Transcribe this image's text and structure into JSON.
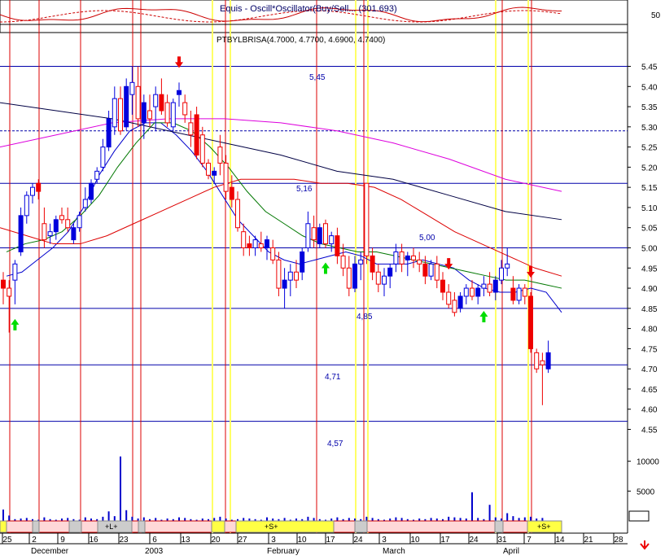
{
  "indicator_panel": {
    "title": "Equis - Oscill*Oscillator(Buy/Sell... (301.693)",
    "axis_label": "50"
  },
  "price_panel": {
    "ohlc_caption": "PTBYLBRISA(4.7000, 4.7700, 4.6900, 4.7400)",
    "y_ticks": [
      "5.45",
      "5.40",
      "5.35",
      "5.30",
      "5.25",
      "5.20",
      "5.15",
      "5.10",
      "5.05",
      "5.00",
      "4.95",
      "4.90",
      "4.85",
      "4.80",
      "4.75",
      "4.70",
      "4.65",
      "4.60",
      "4.55"
    ],
    "level_labels": [
      "5,45",
      "5,16",
      "5,00",
      "4,85",
      "4,71",
      "4,57"
    ]
  },
  "volume_panel": {
    "y_ticks": [
      "10000",
      "5000"
    ]
  },
  "signal_bar": {
    "labels": [
      "+L+",
      "+S+",
      "+S+"
    ]
  },
  "x_axis": {
    "day_labels": [
      "25",
      "2",
      "9",
      "16",
      "23",
      "30",
      "6",
      "13",
      "20",
      "27",
      "3",
      "10",
      "17",
      "24",
      "3",
      "10",
      "17",
      "24",
      "31",
      "7",
      "14",
      "21",
      "28"
    ],
    "month_labels": [
      "December",
      "2003",
      "February",
      "March",
      "April"
    ]
  },
  "colors": {
    "bull_candle": "#0000dd",
    "bear_candle": "#ee0000",
    "support_line": "#0000aa",
    "ma_short": "#0000cc",
    "ma_green": "#007700",
    "ma_red": "#dd0000",
    "ma_magenta": "#dd00dd",
    "ma_long": "#000044",
    "vline_red": "#dd0000",
    "vline_yellow": "#ffff66",
    "arrow_up": "#00dd00",
    "arrow_down": "#ee0000"
  },
  "chart_data": {
    "type": "candlestick",
    "ohlc_last": {
      "open": 4.7,
      "high": 4.77,
      "low": 4.69,
      "close": 4.74
    },
    "ylim": [
      4.55,
      5.45
    ],
    "horizontal_levels": [
      5.45,
      5.29,
      5.16,
      5.0,
      4.85,
      4.71,
      4.57
    ],
    "candles": [
      {
        "o": 4.92,
        "h": 4.94,
        "l": 4.86,
        "c": 4.9
      },
      {
        "o": 4.9,
        "h": 4.92,
        "l": 4.79,
        "c": 4.88
      },
      {
        "o": 4.92,
        "h": 4.97,
        "l": 4.86,
        "c": 4.96
      },
      {
        "o": 4.99,
        "h": 5.1,
        "l": 4.98,
        "c": 5.08
      },
      {
        "o": 5.08,
        "h": 5.14,
        "l": 5.06,
        "c": 5.13
      },
      {
        "o": 5.13,
        "h": 5.16,
        "l": 5.11,
        "c": 5.15
      },
      {
        "o": 5.16,
        "h": 5.17,
        "l": 5.12,
        "c": 5.14
      },
      {
        "o": 5.06,
        "h": 5.1,
        "l": 5.0,
        "c": 5.02
      },
      {
        "o": 5.03,
        "h": 5.06,
        "l": 5.01,
        "c": 5.04
      },
      {
        "o": 5.04,
        "h": 5.08,
        "l": 5.02,
        "c": 5.07
      },
      {
        "o": 5.08,
        "h": 5.1,
        "l": 5.06,
        "c": 5.07
      },
      {
        "o": 5.07,
        "h": 5.1,
        "l": 5.04,
        "c": 5.05
      },
      {
        "o": 5.02,
        "h": 5.06,
        "l": 5.01,
        "c": 5.05
      },
      {
        "o": 5.05,
        "h": 5.09,
        "l": 5.04,
        "c": 5.08
      },
      {
        "o": 5.1,
        "h": 5.15,
        "l": 5.09,
        "c": 5.12
      },
      {
        "o": 5.12,
        "h": 5.17,
        "l": 5.11,
        "c": 5.16
      },
      {
        "o": 5.17,
        "h": 5.2,
        "l": 5.16,
        "c": 5.19
      },
      {
        "o": 5.2,
        "h": 5.27,
        "l": 5.19,
        "c": 5.25
      },
      {
        "o": 5.25,
        "h": 5.34,
        "l": 5.24,
        "c": 5.32
      },
      {
        "o": 5.3,
        "h": 5.4,
        "l": 5.28,
        "c": 5.37
      },
      {
        "o": 5.37,
        "h": 5.4,
        "l": 5.28,
        "c": 5.29
      },
      {
        "o": 5.3,
        "h": 5.42,
        "l": 5.29,
        "c": 5.4
      },
      {
        "o": 5.38,
        "h": 5.45,
        "l": 5.33,
        "c": 5.41
      },
      {
        "o": 5.4,
        "h": 5.45,
        "l": 5.3,
        "c": 5.32
      },
      {
        "o": 5.31,
        "h": 5.38,
        "l": 5.27,
        "c": 5.36
      },
      {
        "o": 5.34,
        "h": 5.38,
        "l": 5.3,
        "c": 5.32
      },
      {
        "o": 5.35,
        "h": 5.4,
        "l": 5.29,
        "c": 5.38
      },
      {
        "o": 5.38,
        "h": 5.42,
        "l": 5.33,
        "c": 5.34
      },
      {
        "o": 5.36,
        "h": 5.38,
        "l": 5.3,
        "c": 5.31
      },
      {
        "o": 5.3,
        "h": 5.37,
        "l": 5.29,
        "c": 5.36
      },
      {
        "o": 5.38,
        "h": 5.41,
        "l": 5.35,
        "c": 5.39
      },
      {
        "o": 5.36,
        "h": 5.38,
        "l": 5.31,
        "c": 5.33
      },
      {
        "o": 5.31,
        "h": 5.34,
        "l": 5.25,
        "c": 5.28
      },
      {
        "o": 5.33,
        "h": 5.35,
        "l": 5.22,
        "c": 5.23
      },
      {
        "o": 5.28,
        "h": 5.3,
        "l": 5.2,
        "c": 5.21
      },
      {
        "o": 5.21,
        "h": 5.22,
        "l": 5.17,
        "c": 5.18
      },
      {
        "o": 5.18,
        "h": 5.2,
        "l": 5.16,
        "c": 5.19
      },
      {
        "o": 5.25,
        "h": 5.28,
        "l": 5.18,
        "c": 5.21
      },
      {
        "o": 5.21,
        "h": 5.23,
        "l": 5.12,
        "c": 5.14
      },
      {
        "o": 5.15,
        "h": 5.18,
        "l": 5.1,
        "c": 5.12
      },
      {
        "o": 5.12,
        "h": 5.14,
        "l": 5.04,
        "c": 5.05
      },
      {
        "o": 5.04,
        "h": 5.06,
        "l": 4.98,
        "c": 5.0
      },
      {
        "o": 5.01,
        "h": 5.03,
        "l": 4.98,
        "c": 5.0
      },
      {
        "o": 5.0,
        "h": 5.03,
        "l": 4.98,
        "c": 5.02
      },
      {
        "o": 5.01,
        "h": 5.04,
        "l": 4.99,
        "c": 5.0
      },
      {
        "o": 5.0,
        "h": 5.03,
        "l": 4.97,
        "c": 5.02
      },
      {
        "o": 5.0,
        "h": 5.02,
        "l": 4.96,
        "c": 4.97
      },
      {
        "o": 4.97,
        "h": 4.99,
        "l": 4.88,
        "c": 4.9
      },
      {
        "o": 4.9,
        "h": 4.95,
        "l": 4.85,
        "c": 4.92
      },
      {
        "o": 4.92,
        "h": 4.96,
        "l": 4.88,
        "c": 4.94
      },
      {
        "o": 4.94,
        "h": 4.97,
        "l": 4.9,
        "c": 4.92
      },
      {
        "o": 4.94,
        "h": 5.0,
        "l": 4.92,
        "c": 4.99
      },
      {
        "o": 5.0,
        "h": 5.09,
        "l": 4.99,
        "c": 5.06
      },
      {
        "o": 5.05,
        "h": 5.08,
        "l": 5.0,
        "c": 5.02
      },
      {
        "o": 5.01,
        "h": 5.06,
        "l": 5.0,
        "c": 5.05
      },
      {
        "o": 5.06,
        "h": 5.07,
        "l": 5.0,
        "c": 5.01
      },
      {
        "o": 5.01,
        "h": 5.04,
        "l": 4.99,
        "c": 5.03
      },
      {
        "o": 5.03,
        "h": 5.05,
        "l": 4.96,
        "c": 4.98
      },
      {
        "o": 4.98,
        "h": 5.01,
        "l": 4.93,
        "c": 4.95
      },
      {
        "o": 4.95,
        "h": 4.98,
        "l": 4.88,
        "c": 4.9
      },
      {
        "o": 4.9,
        "h": 4.98,
        "l": 4.89,
        "c": 4.96
      },
      {
        "o": 4.96,
        "h": 4.99,
        "l": 4.92,
        "c": 4.97
      },
      {
        "o": 5.16,
        "h": 5.16,
        "l": 4.96,
        "c": 4.98
      },
      {
        "o": 4.98,
        "h": 5.0,
        "l": 4.92,
        "c": 4.94
      },
      {
        "o": 4.94,
        "h": 4.96,
        "l": 4.89,
        "c": 4.91
      },
      {
        "o": 4.91,
        "h": 4.95,
        "l": 4.88,
        "c": 4.93
      },
      {
        "o": 4.93,
        "h": 4.96,
        "l": 4.9,
        "c": 4.95
      },
      {
        "o": 4.96,
        "h": 5.01,
        "l": 4.94,
        "c": 4.99
      },
      {
        "o": 4.99,
        "h": 5.01,
        "l": 4.94,
        "c": 4.96
      },
      {
        "o": 4.97,
        "h": 4.99,
        "l": 4.93,
        "c": 4.98
      },
      {
        "o": 4.98,
        "h": 5.0,
        "l": 4.95,
        "c": 4.97
      },
      {
        "o": 4.97,
        "h": 4.99,
        "l": 4.94,
        "c": 4.96
      },
      {
        "o": 4.96,
        "h": 4.98,
        "l": 4.91,
        "c": 4.93
      },
      {
        "o": 4.93,
        "h": 4.97,
        "l": 4.92,
        "c": 4.96
      },
      {
        "o": 4.96,
        "h": 4.98,
        "l": 4.9,
        "c": 4.92
      },
      {
        "o": 4.92,
        "h": 4.94,
        "l": 4.87,
        "c": 4.89
      },
      {
        "o": 4.89,
        "h": 4.91,
        "l": 4.85,
        "c": 4.86
      },
      {
        "o": 4.87,
        "h": 4.89,
        "l": 4.83,
        "c": 4.84
      },
      {
        "o": 4.85,
        "h": 4.89,
        "l": 4.84,
        "c": 4.88
      },
      {
        "o": 4.88,
        "h": 4.91,
        "l": 4.86,
        "c": 4.9
      },
      {
        "o": 4.9,
        "h": 4.92,
        "l": 4.87,
        "c": 4.88
      },
      {
        "o": 4.88,
        "h": 4.91,
        "l": 4.86,
        "c": 4.9
      },
      {
        "o": 4.9,
        "h": 4.93,
        "l": 4.88,
        "c": 4.91
      },
      {
        "o": 4.91,
        "h": 4.94,
        "l": 4.88,
        "c": 4.89
      },
      {
        "o": 4.89,
        "h": 4.93,
        "l": 4.87,
        "c": 4.92
      },
      {
        "o": 4.92,
        "h": 4.97,
        "l": 4.91,
        "c": 4.95
      },
      {
        "o": 4.95,
        "h": 5.0,
        "l": 4.93,
        "c": 4.96
      },
      {
        "o": 4.9,
        "h": 4.93,
        "l": 4.86,
        "c": 4.87
      },
      {
        "o": 4.87,
        "h": 4.91,
        "l": 4.86,
        "c": 4.9
      },
      {
        "o": 4.9,
        "h": 4.91,
        "l": 4.86,
        "c": 4.88
      },
      {
        "o": 4.88,
        "h": 4.89,
        "l": 4.74,
        "c": 4.75
      },
      {
        "o": 4.74,
        "h": 4.75,
        "l": 4.69,
        "c": 4.7
      },
      {
        "o": 4.72,
        "h": 4.74,
        "l": 4.61,
        "c": 4.71
      },
      {
        "o": 4.7,
        "h": 4.77,
        "l": 4.69,
        "c": 4.74
      }
    ],
    "moving_averages": [
      {
        "name": "short",
        "points": [
          4.93,
          4.94,
          4.97,
          5.0,
          5.04,
          5.1,
          5.18,
          5.24,
          5.29,
          5.31,
          5.31,
          5.28,
          5.24,
          5.19,
          5.13,
          5.07,
          5.03,
          4.99,
          4.97,
          4.96,
          4.97,
          4.98,
          4.99,
          4.98,
          4.96,
          4.96,
          4.96,
          4.97,
          4.96,
          4.95,
          4.92,
          4.9,
          4.89,
          4.89,
          4.9,
          4.89,
          4.84
        ]
      },
      {
        "name": "green",
        "points": [
          4.99,
          5.01,
          5.02,
          5.04,
          5.08,
          5.13,
          5.2,
          5.26,
          5.31,
          5.31,
          5.29,
          5.25,
          5.2,
          5.14,
          5.09,
          5.06,
          5.03,
          5.01,
          5.0,
          4.99,
          4.99,
          4.98,
          4.97,
          4.96,
          4.95,
          4.94,
          4.93,
          4.92,
          4.92,
          4.91,
          4.9
        ]
      },
      {
        "name": "red",
        "points": [
          5.05,
          5.03,
          5.01,
          5.01,
          5.03,
          5.06,
          5.09,
          5.12,
          5.15,
          5.17,
          5.17,
          5.17,
          5.16,
          5.16,
          5.15,
          5.12,
          5.08,
          5.04,
          5.01,
          4.98,
          4.95,
          4.93
        ]
      },
      {
        "name": "magenta",
        "points": [
          5.25,
          5.28,
          5.31,
          5.32,
          5.32,
          5.31,
          5.29,
          5.26,
          5.22,
          5.17,
          5.14
        ]
      },
      {
        "name": "long",
        "points": [
          5.36,
          5.34,
          5.32,
          5.29,
          5.26,
          5.23,
          5.19,
          5.17,
          5.13,
          5.09,
          5.07
        ]
      }
    ],
    "signals": [
      {
        "type": "up",
        "candle": 2
      },
      {
        "type": "down",
        "candle": 30
      },
      {
        "type": "up",
        "candle": 55
      },
      {
        "type": "down",
        "candle": 76
      },
      {
        "type": "up",
        "candle": 82
      },
      {
        "type": "down",
        "candle": 90
      }
    ],
    "volume": [
      1900,
      900,
      300,
      400,
      500,
      300,
      200,
      600,
      300,
      200,
      400,
      500,
      300,
      200,
      600,
      400,
      300,
      700,
      1600,
      800,
      10800,
      1800,
      700,
      400,
      600,
      300,
      500,
      200,
      400,
      300,
      600,
      500,
      300,
      200,
      400,
      300,
      500,
      700,
      400,
      200,
      300,
      500,
      400,
      300,
      200,
      600,
      400,
      300,
      500,
      200,
      400,
      300,
      700,
      500,
      300,
      200,
      400,
      600,
      300,
      500,
      400,
      300,
      700,
      500,
      300,
      200,
      400,
      600,
      500,
      300,
      200,
      400,
      300,
      500,
      400,
      300,
      700,
      600,
      500,
      400,
      4800,
      500,
      300,
      2700,
      600,
      400,
      1300,
      800,
      500,
      600,
      700,
      400,
      500
    ]
  }
}
